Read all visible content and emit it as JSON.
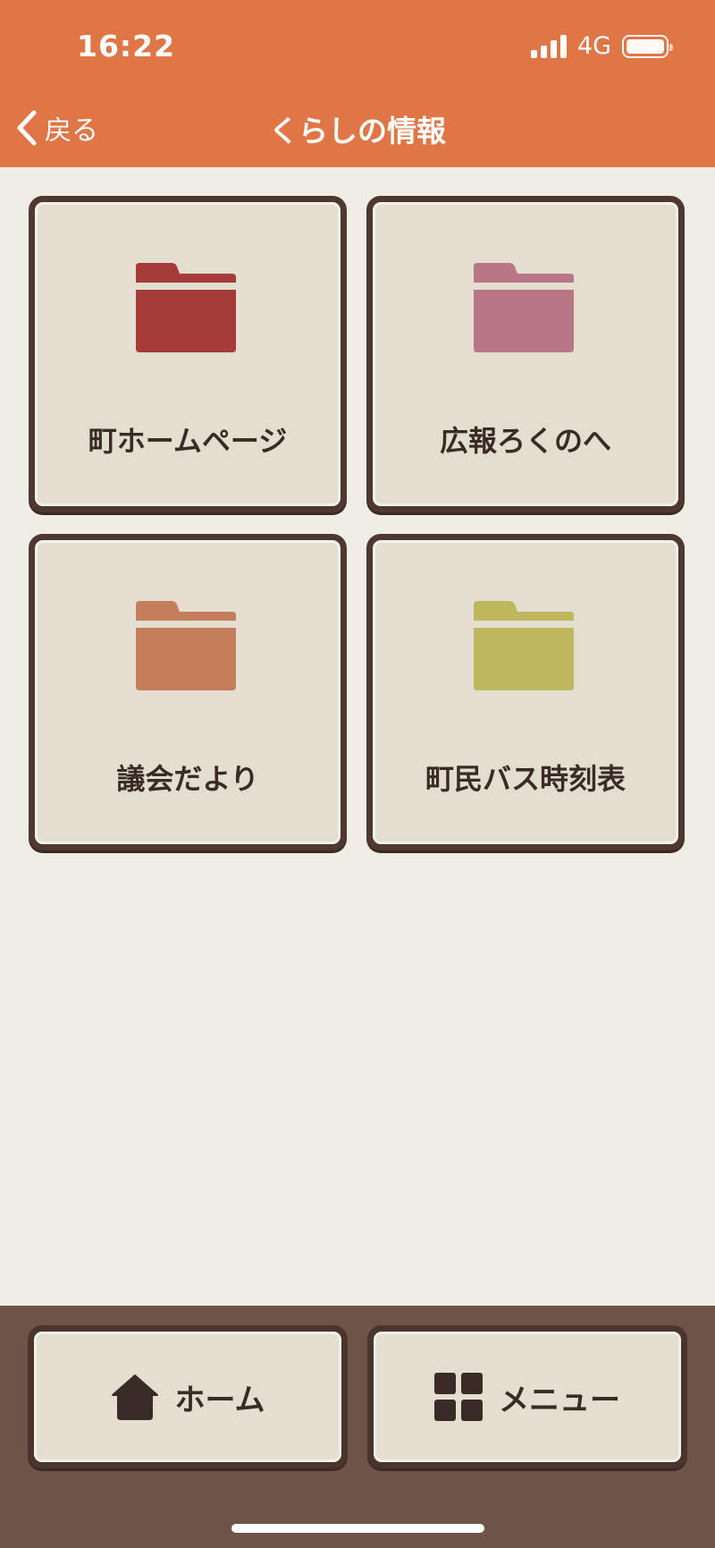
{
  "status_bar": {
    "time": "16:22",
    "network": "4G"
  },
  "header": {
    "back_label": "戻る",
    "title": "くらしの情報",
    "background": "#e07645"
  },
  "tiles": [
    {
      "label": "町ホームページ",
      "icon": "folder-icon",
      "color": "#a63c3a"
    },
    {
      "label": "広報ろくのへ",
      "icon": "folder-icon",
      "color": "#b77787"
    },
    {
      "label": "議会だより",
      "icon": "folder-icon",
      "color": "#c47e5c"
    },
    {
      "label": "町民バス時刻表",
      "icon": "folder-icon",
      "color": "#bfb75e"
    }
  ],
  "bottom_nav": {
    "home_label": "ホーム",
    "menu_label": "メニュー",
    "home_icon": "house-icon",
    "menu_icon": "grid-icon",
    "background": "#6e5448"
  }
}
